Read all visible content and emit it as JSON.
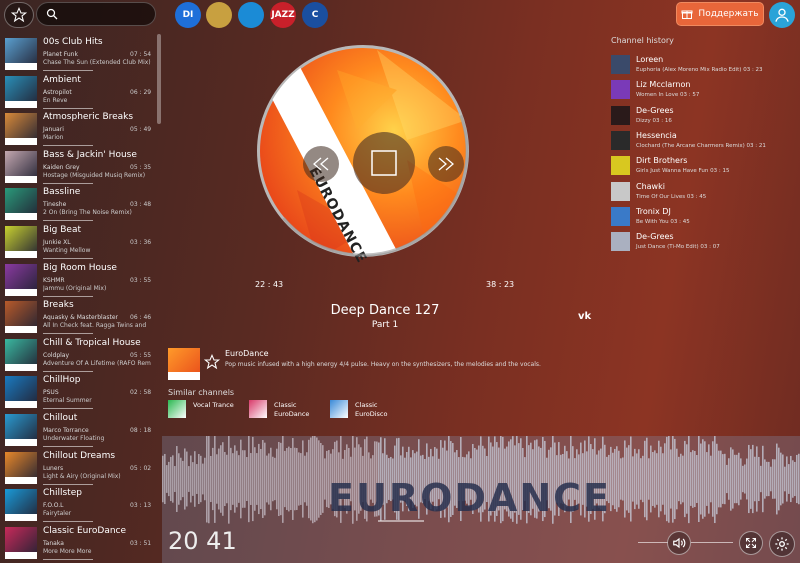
{
  "search": {
    "placeholder": ""
  },
  "networks": [
    {
      "label": "DI",
      "color": "#1e6fd9",
      "icon": "di-logo"
    },
    {
      "label": "",
      "color": "#c8a040",
      "icon": "saxophone-logo"
    },
    {
      "label": "",
      "color": "#1b8bd6",
      "icon": "rockradio-logo"
    },
    {
      "label": "JAZZ",
      "color": "#c8202a",
      "icon": "jazzradio-logo"
    },
    {
      "label": "C",
      "color": "#1a4fa0",
      "icon": "classical-logo"
    }
  ],
  "support": {
    "label": "Поддержать",
    "icon": "gift-icon"
  },
  "sidebar": {
    "channels": [
      {
        "name": "00s Club Hits",
        "artist": "Planet Funk",
        "track": "Chase The Sun (Extended Club Mix)",
        "time": "07 : 54",
        "color": "#5aa0d0"
      },
      {
        "name": "Ambient",
        "artist": "Astropilot",
        "track": "En Reve",
        "time": "06 : 29",
        "color": "#2a8fb8"
      },
      {
        "name": "Atmospheric Breaks",
        "artist": "Januari",
        "track": "Marion",
        "time": "05 : 49",
        "color": "#d88a3a"
      },
      {
        "name": "Bass & Jackin' House",
        "artist": "Kaiden Grey",
        "track": "Hostage (Misguided Musiq Remix)",
        "time": "05 : 35",
        "color": "#c4a8b0"
      },
      {
        "name": "Bassline",
        "artist": "Tineshe",
        "track": "2 On (Bring The Noise Remix)",
        "time": "03 : 48",
        "color": "#2a9a7a"
      },
      {
        "name": "Big Beat",
        "artist": "Junkie XL",
        "track": "Wanting Mellow",
        "time": "03 : 36",
        "color": "#c8d030"
      },
      {
        "name": "Big Room House",
        "artist": "KSHMR",
        "track": "Jammu (Original Mix)",
        "time": "03 : 55",
        "color": "#8a3aa0"
      },
      {
        "name": "Breaks",
        "artist": "Aquasky & Masterblaster",
        "track": "All In Check feat. Ragga Twins and",
        "time": "06 : 46",
        "color": "#b85a2a"
      },
      {
        "name": "Chill & Tropical House",
        "artist": "Coldplay",
        "track": "Adventure Of A Lifetime (RAFO Remix)",
        "time": "05 : 55",
        "color": "#3ab8a0"
      },
      {
        "name": "ChillHop",
        "artist": "PSUS",
        "track": "Eternal Summer",
        "time": "02 : 58",
        "color": "#1a7ac0"
      },
      {
        "name": "Chillout",
        "artist": "Marco Torrance",
        "track": "Underwater Floating",
        "time": "08 : 18",
        "color": "#2a9ad0"
      },
      {
        "name": "Chillout Dreams",
        "artist": "Luners",
        "track": "Light & Airy (Original Mix)",
        "time": "05 : 02",
        "color": "#e8882a"
      },
      {
        "name": "Chillstep",
        "artist": "F.O.O.L",
        "track": "Fairytaler",
        "time": "03 : 13",
        "color": "#1a9ad8"
      },
      {
        "name": "Classic EuroDance",
        "artist": "Tanaka",
        "track": "More More More",
        "time": "03 : 51",
        "color": "#c82a5a"
      }
    ]
  },
  "player": {
    "brand_on_disc": "EURODANCE",
    "elapsed": "22 : 43",
    "remaining": "38 : 23",
    "title": "Deep Dance 127",
    "subtitle": "Part 1",
    "share": "vk"
  },
  "channel_info": {
    "name": "EuroDance",
    "description": "Pop music infused with a high energy 4/4 pulse. Heavy on the synthesizers, the melodies and the vocals."
  },
  "similar": {
    "title": "Similar channels",
    "items": [
      {
        "name": "Vocal Trance",
        "color": "#2ab850"
      },
      {
        "name": "Classic EuroDance",
        "color": "#d83a6a"
      },
      {
        "name": "Classic EuroDisco",
        "color": "#3a8ad8"
      }
    ]
  },
  "history": {
    "title": "Channel history",
    "items": [
      {
        "artist": "Loreen",
        "track": "Euphoria (Alex Moreno Mix Radio Edit) 03 : 23",
        "color": "#3a4a6a"
      },
      {
        "artist": "Liz Mcclarnon",
        "track": "Women In Love 03 : 57",
        "color": "#7a3ab8"
      },
      {
        "artist": "De-Grees",
        "track": "Dizzy 03 : 16",
        "color": "#2a1a1a"
      },
      {
        "artist": "Hessencia",
        "track": "Clochard (The Arcane Charmers Remix) 03 : 21",
        "color": "#2a2a2a"
      },
      {
        "artist": "Dirt Brothers",
        "track": "Girls Just Wanna Have Fun 03 : 15",
        "color": "#d8c820"
      },
      {
        "artist": "Chawki",
        "track": "Time Of Our Lives 03 : 45",
        "color": "#c8c8c8"
      },
      {
        "artist": "Tronix DJ",
        "track": "Be With You 03 : 45",
        "color": "#3a7ac8"
      },
      {
        "artist": "De-Grees",
        "track": "Just Dance (Ti-Mo Edit) 03 : 07",
        "color": "#aab0c0"
      }
    ]
  },
  "footer": {
    "clock": "20 41",
    "brand": "EURODANCE"
  }
}
